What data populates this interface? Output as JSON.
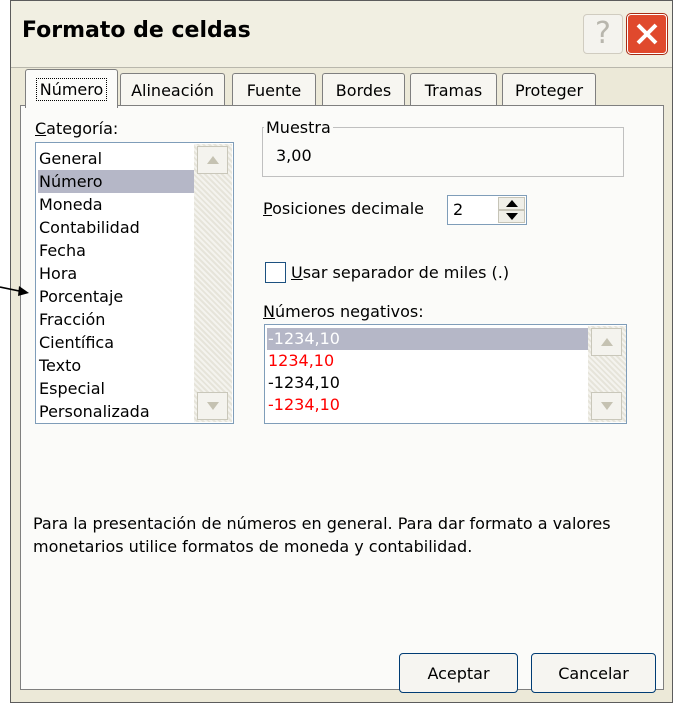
{
  "window": {
    "title": "Formato de celdas"
  },
  "tabs": [
    {
      "label": "Número",
      "active": true
    },
    {
      "label": "Alineación",
      "active": false
    },
    {
      "label": "Fuente",
      "active": false
    },
    {
      "label": "Bordes",
      "active": false
    },
    {
      "label": "Tramas",
      "active": false
    },
    {
      "label": "Proteger",
      "active": false
    }
  ],
  "category": {
    "label_first": "C",
    "label_rest": "ategoría:",
    "items": [
      "General",
      "Número",
      "Moneda",
      "Contabilidad",
      "Fecha",
      "Hora",
      "Porcentaje",
      "Fracción",
      "Científica",
      "Texto",
      "Especial",
      "Personalizada"
    ],
    "selected": "Número"
  },
  "sample": {
    "legend": "Muestra",
    "value": "3,00"
  },
  "decimals": {
    "label_first": "P",
    "label_rest": "osiciones decimale",
    "value": "2"
  },
  "thousands": {
    "label_first": "U",
    "label_rest": "sar separador de miles (.)",
    "checked": false
  },
  "negatives": {
    "label_first": "N",
    "label_rest": "úmeros negativos:",
    "items": [
      {
        "text": "-1234,10",
        "color": "#ffffff",
        "selected": true
      },
      {
        "text": "1234,10",
        "color": "#ff0000",
        "selected": false
      },
      {
        "text": "-1234,10",
        "color": "#000000",
        "selected": false
      },
      {
        "text": "-1234,10",
        "color": "#ff0000",
        "selected": false
      }
    ]
  },
  "description": "Para la presentación de números en general. Para dar formato a valores monetarios utilice formatos de moneda y contabilidad.",
  "buttons": {
    "ok": "Aceptar",
    "cancel": "Cancelar"
  },
  "colors": {
    "close": "#e0492d",
    "selection": "#b5b7c7",
    "negative_red": "#ff0000"
  }
}
